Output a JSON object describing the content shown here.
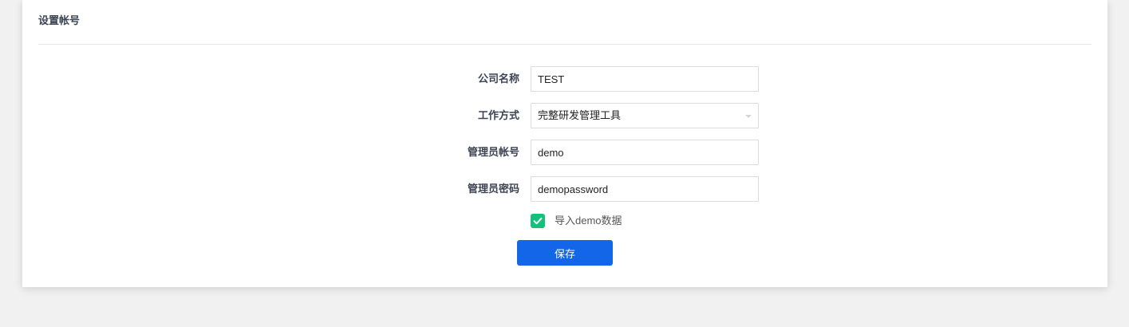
{
  "panel": {
    "title": "设置帐号"
  },
  "form": {
    "company": {
      "label": "公司名称",
      "value": "TEST"
    },
    "mode": {
      "label": "工作方式",
      "value": "完整研发管理工具"
    },
    "account": {
      "label": "管理员帐号",
      "value": "demo"
    },
    "password": {
      "label": "管理员密码",
      "value": "demopassword"
    },
    "import_demo": {
      "label": "导入demo数据",
      "checked": true
    },
    "save_label": "保存"
  },
  "colors": {
    "accent": "#1366e8",
    "checkbox": "#13c27a",
    "background": "#f1f1f1"
  }
}
